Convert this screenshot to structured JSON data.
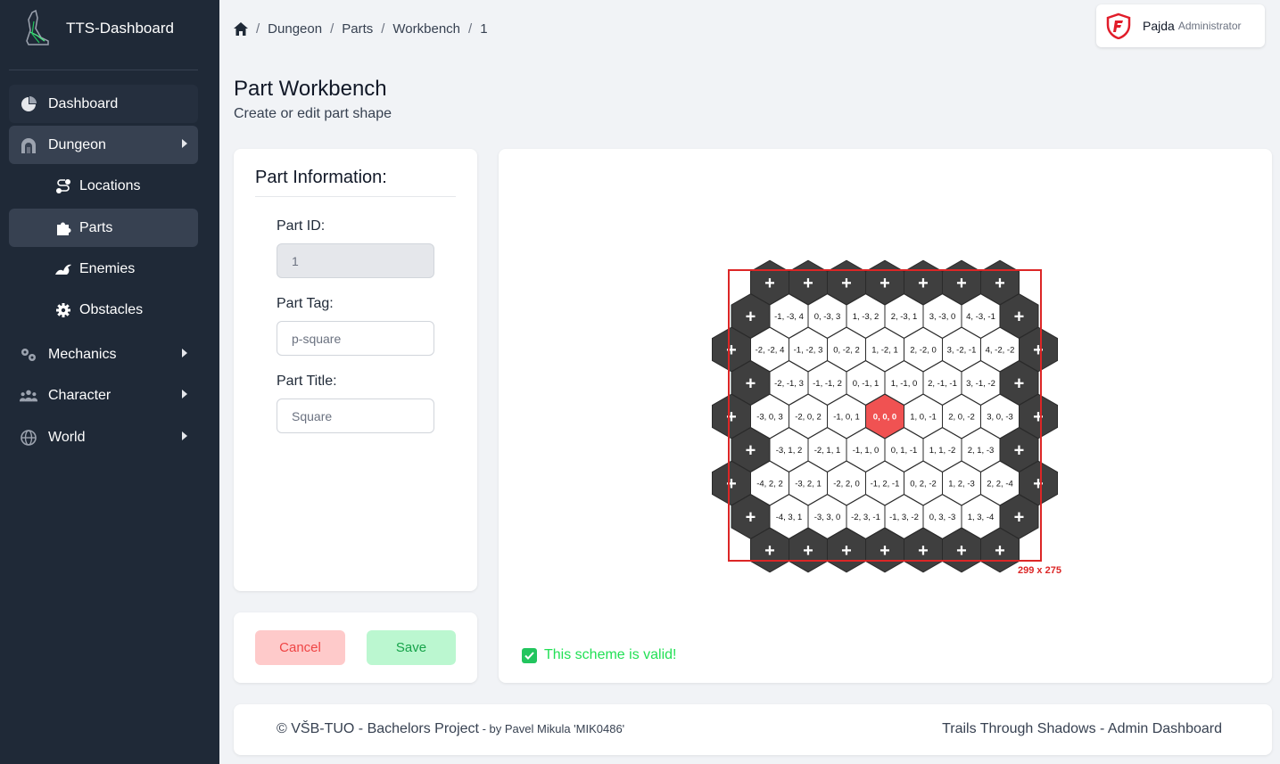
{
  "app": {
    "title": "TTS-Dashboard"
  },
  "sidebar": {
    "items": [
      {
        "label": "Dashboard",
        "icon": "pie-chart-icon"
      },
      {
        "label": "Dungeon",
        "icon": "dungeon-icon"
      },
      {
        "label": "Locations",
        "icon": "route-icon"
      },
      {
        "label": "Parts",
        "icon": "puzzle-icon"
      },
      {
        "label": "Enemies",
        "icon": "dragon-icon"
      },
      {
        "label": "Obstacles",
        "icon": "gear-icon"
      },
      {
        "label": "Mechanics",
        "icon": "cogs-icon"
      },
      {
        "label": "Character",
        "icon": "users-icon"
      },
      {
        "label": "World",
        "icon": "globe-icon"
      }
    ]
  },
  "breadcrumb": [
    "Dungeon",
    "Parts",
    "Workbench",
    "1"
  ],
  "user": {
    "name": "Pajda",
    "role": "Administrator"
  },
  "page": {
    "title": "Part Workbench",
    "subtitle": "Create or edit part shape"
  },
  "part_info": {
    "heading": "Part Information:",
    "id_label": "Part ID:",
    "id_value": "1",
    "tag_label": "Part Tag:",
    "tag_placeholder": "p-square",
    "title_label": "Part Title:",
    "title_placeholder": "Square"
  },
  "actions": {
    "cancel": "Cancel",
    "save": "Save"
  },
  "workbench": {
    "selection_size": "299 x 275",
    "valid_message": "This scheme is valid!",
    "rows": [
      [
        "+",
        "+",
        "+",
        "+",
        "+",
        "+",
        "+"
      ],
      [
        "+",
        "-1, -3, 4",
        "0, -3, 3",
        "1, -3, 2",
        "2, -3, 1",
        "3, -3, 0",
        "4, -3, -1",
        "+"
      ],
      [
        "+",
        "-2, -2, 4",
        "-1, -2, 3",
        "0, -2, 2",
        "1, -2, 1",
        "2, -2, 0",
        "3, -2, -1",
        "4, -2, -2",
        "+"
      ],
      [
        "+",
        "-2, -1, 3",
        "-1, -1, 2",
        "0, -1, 1",
        "1, -1, 0",
        "2, -1, -1",
        "3, -1, -2",
        "+"
      ],
      [
        "+",
        "-3, 0, 3",
        "-2, 0, 2",
        "-1, 0, 1",
        "0, 0, 0",
        "1, 0, -1",
        "2, 0, -2",
        "3, 0, -3",
        "+"
      ],
      [
        "+",
        "-3, 1, 2",
        "-2, 1, 1",
        "-1, 1, 0",
        "0, 1, -1",
        "1, 1, -2",
        "2, 1, -3",
        "+"
      ],
      [
        "+",
        "-4, 2, 2",
        "-3, 2, 1",
        "-2, 2, 0",
        "-1, 2, -1",
        "0, 2, -2",
        "1, 2, -3",
        "2, 2, -4",
        "+"
      ],
      [
        "+",
        "-4, 3, 1",
        "-3, 3, 0",
        "-2, 3, -1",
        "-1, 3, -2",
        "0, 3, -3",
        "1, 3, -4",
        "+"
      ],
      [
        "+",
        "+",
        "+",
        "+",
        "+",
        "+",
        "+"
      ]
    ],
    "center_hex": "0, 0, 0",
    "colors": {
      "center": "#f05252",
      "add": "#3f3f3f",
      "cell": "#ffffff",
      "selection": "#dc2626"
    }
  },
  "footer": {
    "left": "© VŠB-TUO - Bachelors Project",
    "by": " - by Pavel Mikula 'MIK0486'",
    "right": "Trails Through Shadows - Admin Dashboard"
  }
}
